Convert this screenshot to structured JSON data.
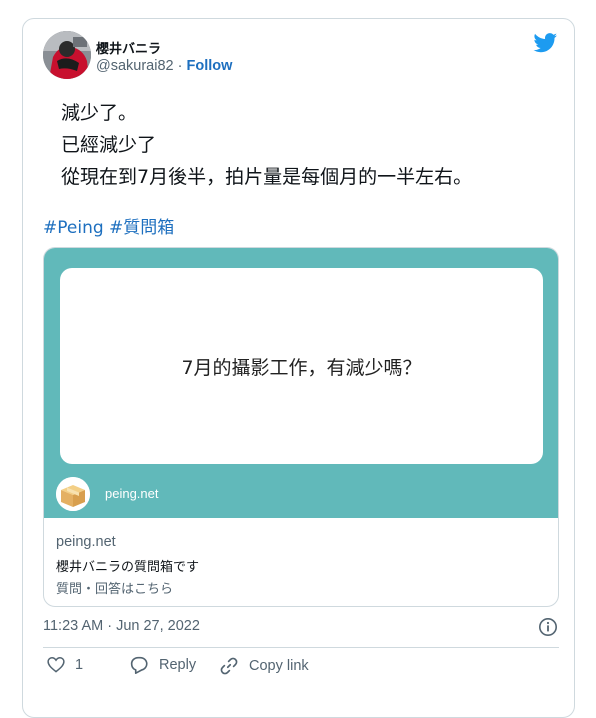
{
  "author": {
    "display_name": "櫻井バニラ",
    "handle": "@sakurai82",
    "separator": " · ",
    "follow_label": "Follow"
  },
  "tweet": {
    "lines": [
      "減少了。",
      "已經減少了",
      "從現在到7月後半，拍片量是每個月的一半左右。"
    ],
    "hashtags": [
      "#Peing",
      "#質問箱"
    ],
    "timestamp": "11:23 AM · Jun 27, 2022"
  },
  "card": {
    "question": "7月的攝影工作，有減少嗎？",
    "image_site": "peing.net",
    "domain": "peing.net",
    "title": "櫻井バニラの質問箱です",
    "description": "質問・回答はこちら"
  },
  "actions": {
    "like_count": "1",
    "reply_label": "Reply",
    "copy_link_label": "Copy link"
  },
  "icons": {
    "brand": "twitter-bird-icon",
    "info": "info-icon",
    "like": "heart-icon",
    "reply": "reply-bubble-icon",
    "copy": "link-icon"
  },
  "colors": {
    "link": "#1d6fbf",
    "brand": "#1d9bf0",
    "card_background": "#61b9ba",
    "border": "#cfd9de",
    "muted_text": "#536471"
  }
}
